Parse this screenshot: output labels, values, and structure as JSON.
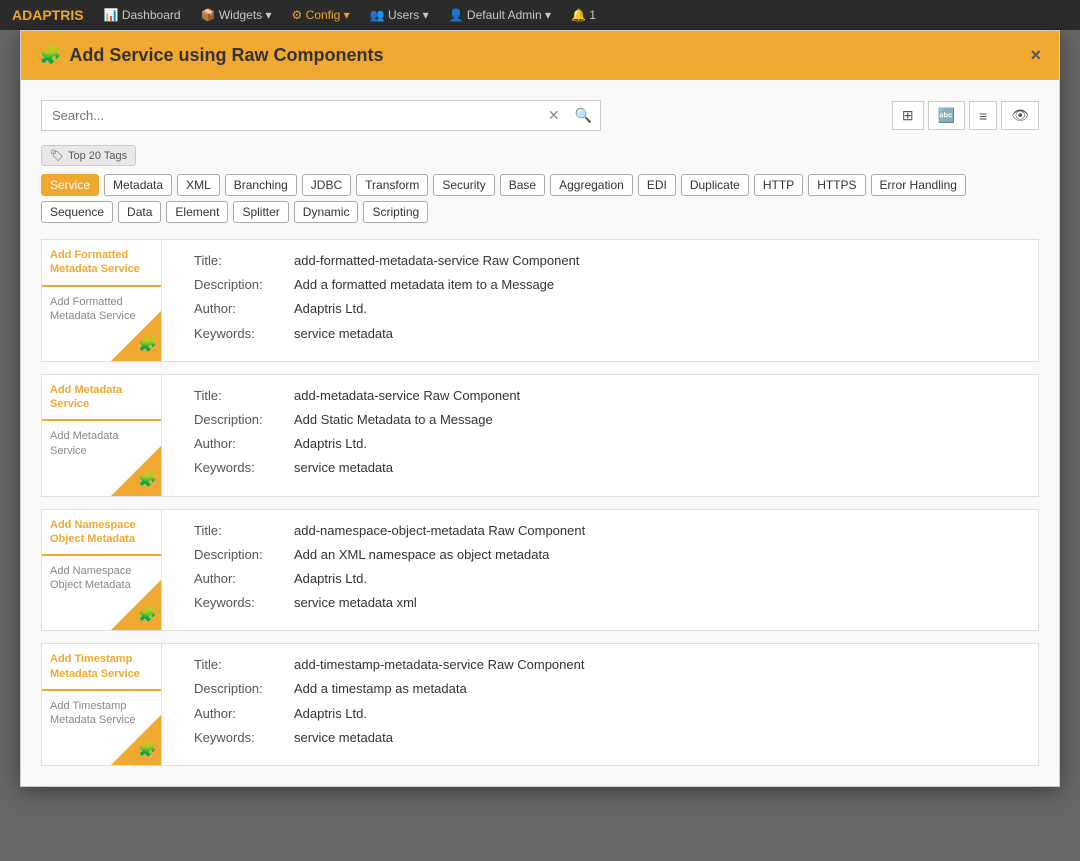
{
  "modal": {
    "title": "Add Service using Raw Components",
    "close_label": "×"
  },
  "search": {
    "placeholder": "Search...",
    "value": "",
    "clear_icon": "✕",
    "search_icon": "🔍"
  },
  "toolbar": {
    "grid_icon": "⊞",
    "sort_az_icon": "🔤",
    "sort_num_icon": "🔢",
    "eye_icon": "👁"
  },
  "tags": {
    "label": "Top 20 Tags",
    "items": [
      "Service",
      "Metadata",
      "XML",
      "Branching",
      "JDBC",
      "Transform",
      "Security",
      "Base",
      "Aggregation",
      "EDI",
      "Duplicate",
      "HTTP",
      "HTTPS",
      "Error Handling",
      "Sequence",
      "Data",
      "Element",
      "Splitter",
      "Dynamic",
      "Scripting"
    ]
  },
  "results": [
    {
      "card_title": "Add Formatted Metadata Service",
      "card_subtitle": "Add Formatted Metadata Service",
      "title_value": "add-formatted-metadata-service Raw Component",
      "description_value": "Add a formatted metadata item to a Message",
      "author_value": "Adaptris Ltd.",
      "keywords_value": "service metadata"
    },
    {
      "card_title": "Add Metadata Service",
      "card_subtitle": "Add Metadata Service",
      "title_value": "add-metadata-service Raw Component",
      "description_value": "Add Static Metadata to a Message",
      "author_value": "Adaptris Ltd.",
      "keywords_value": "service metadata"
    },
    {
      "card_title": "Add Namespace Object Metadata",
      "card_subtitle": "Add Namespace Object Metadata",
      "title_value": "add-namespace-object-metadata Raw Component",
      "description_value": "Add an XML namespace as object metadata",
      "author_value": "Adaptris Ltd.",
      "keywords_value": "service metadata xml"
    },
    {
      "card_title": "Add Timestamp Metadata Service",
      "card_subtitle": "Add Timestamp Metadata Service",
      "title_value": "add-timestamp-metadata-service Raw Component",
      "description_value": "Add a timestamp as metadata",
      "author_value": "Adaptris Ltd.",
      "keywords_value": "service metadata"
    }
  ],
  "labels": {
    "title": "Title:",
    "description": "Description:",
    "author": "Author:",
    "keywords": "Keywords:",
    "top20tags": "Top 20 Tags"
  }
}
